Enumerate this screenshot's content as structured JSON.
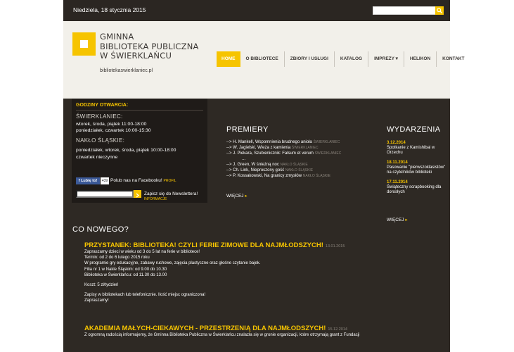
{
  "topbar": {
    "date": "Niedziela, 18 stycznia 2015",
    "search_placeholder": ""
  },
  "colors": {
    "accent": "#f6c400",
    "dark_bg": "#2e2924",
    "header_bg": "#f2f0ea"
  },
  "brand": {
    "title_lines": [
      "GMINNA",
      "BIBLIOTEKA PUBLICZNA",
      "W ŚWIERKLAŃCU"
    ],
    "url": "bibliotekaswierklaniec.pl"
  },
  "nav": [
    "HOME",
    "O BIBLIOTECE",
    "ZBIORY I USŁUGI",
    "KATALOG",
    "IMPREZY ▾",
    "HELIKON",
    "KONTAKT"
  ],
  "hours": {
    "title": "GODZINY OTWARCIA:",
    "loc1": "ŚWIERKLANIEC:",
    "loc1_lines": [
      "wtorek, środa, piątek 11:00-18:00",
      "poniedziałek, czwartek 10:00-15:30"
    ],
    "loc2": "NAKŁO ŚLĄSKIE:",
    "loc2_lines": [
      "poniedziałek, wtorek, środa, piątek 10:00-18:00",
      "czwartek nieczynne"
    ]
  },
  "social": {
    "fb_button": "f Lubię to!",
    "fb_count": "439",
    "fb_text": "Polub nas na Facebooku!",
    "fb_profil": "PROFIL",
    "newsletter_text": "Zapisz się do Newslettera!",
    "newsletter_info": "INFORMACJE"
  },
  "premiery": {
    "title": "PREMIERY",
    "items": [
      {
        "text": "--> H. Mankell, Wspomnienia brudnego anioła",
        "loc": "ŚWIERKLANIEC"
      },
      {
        "text": "--> W. Jagielski, Wieża z kamienia",
        "loc": "ŚWIERKLANIEC"
      },
      {
        "text": "--> J. Piekara, Szubienicznik: Falsum et verum",
        "loc": "ŚWIERKLANIEC"
      }
    ],
    "gap": "...",
    "items2": [
      {
        "text": "--> J. Green, W śnieżną noc",
        "loc": "NAKŁO ŚLĄSKIE"
      },
      {
        "text": "--> Ch. Link, Nieproszony gość",
        "loc": "NAKŁO ŚLĄSKIE"
      },
      {
        "text": "--> P. Kossakowski, Na granicy zmysłów",
        "loc": "NAKŁO ŚLĄSKIE"
      }
    ],
    "more": "WIĘCEJ"
  },
  "wydarzenia": {
    "title": "WYDARZENIA",
    "items": [
      {
        "date": "3.12.2014",
        "text": "Spotkanie z Kamishibai w Orzechu"
      },
      {
        "date": "18.11.2014",
        "text": "Pasowanie \"pierwszoklasistów\" na czytelników biblioteki"
      },
      {
        "date": "17.11.2014",
        "text": "Świąteczny scrapbooking dla dorosłych"
      }
    ],
    "more": "WIĘCEJ"
  },
  "news": {
    "title": "CO NOWEGO?",
    "article1": {
      "title": "PRZYSTANEK: BIBLIOTEKA! CZYLI FERIE ZIMOWE DLA NAJMŁODSZYCH!",
      "date": "13.01.2015",
      "lines": [
        "Zapraszamy dzieci w wieku od 3 do 5 lat na ferie w bibliotece!",
        "Termin: od 2 do 6 lutego 2015 roku",
        "W programie gry edukacyjne, zabawy ruchowe, zajęcia plastyczne oraz głośne czytanie bajek.",
        "Filia nr 1 w Nakle Śląskim: od 9.00 do 10.30",
        "Biblioteka w Świerklańcu: od 11.30 do 13.00"
      ],
      "cost": "Koszt: 5 zł/tydzień",
      "signup": [
        "Zapisy w bibliotekach lub telefonicznie. Ilość miejsc ograniczona!",
        "Zapraszamy!"
      ]
    },
    "article2": {
      "title": "AKADEMIA MAŁYCH-CIEKAWYCH - PRZESTRZENIĄ DLA NAJMŁODSZYCH!",
      "date": "15.12.2014",
      "line": "Z ogromną radością informujemy, że Gminna Biblioteka Publiczna w Świerklańcu znalazła się w gronie organizacji, które otrzymają grant z Fundacji"
    }
  }
}
